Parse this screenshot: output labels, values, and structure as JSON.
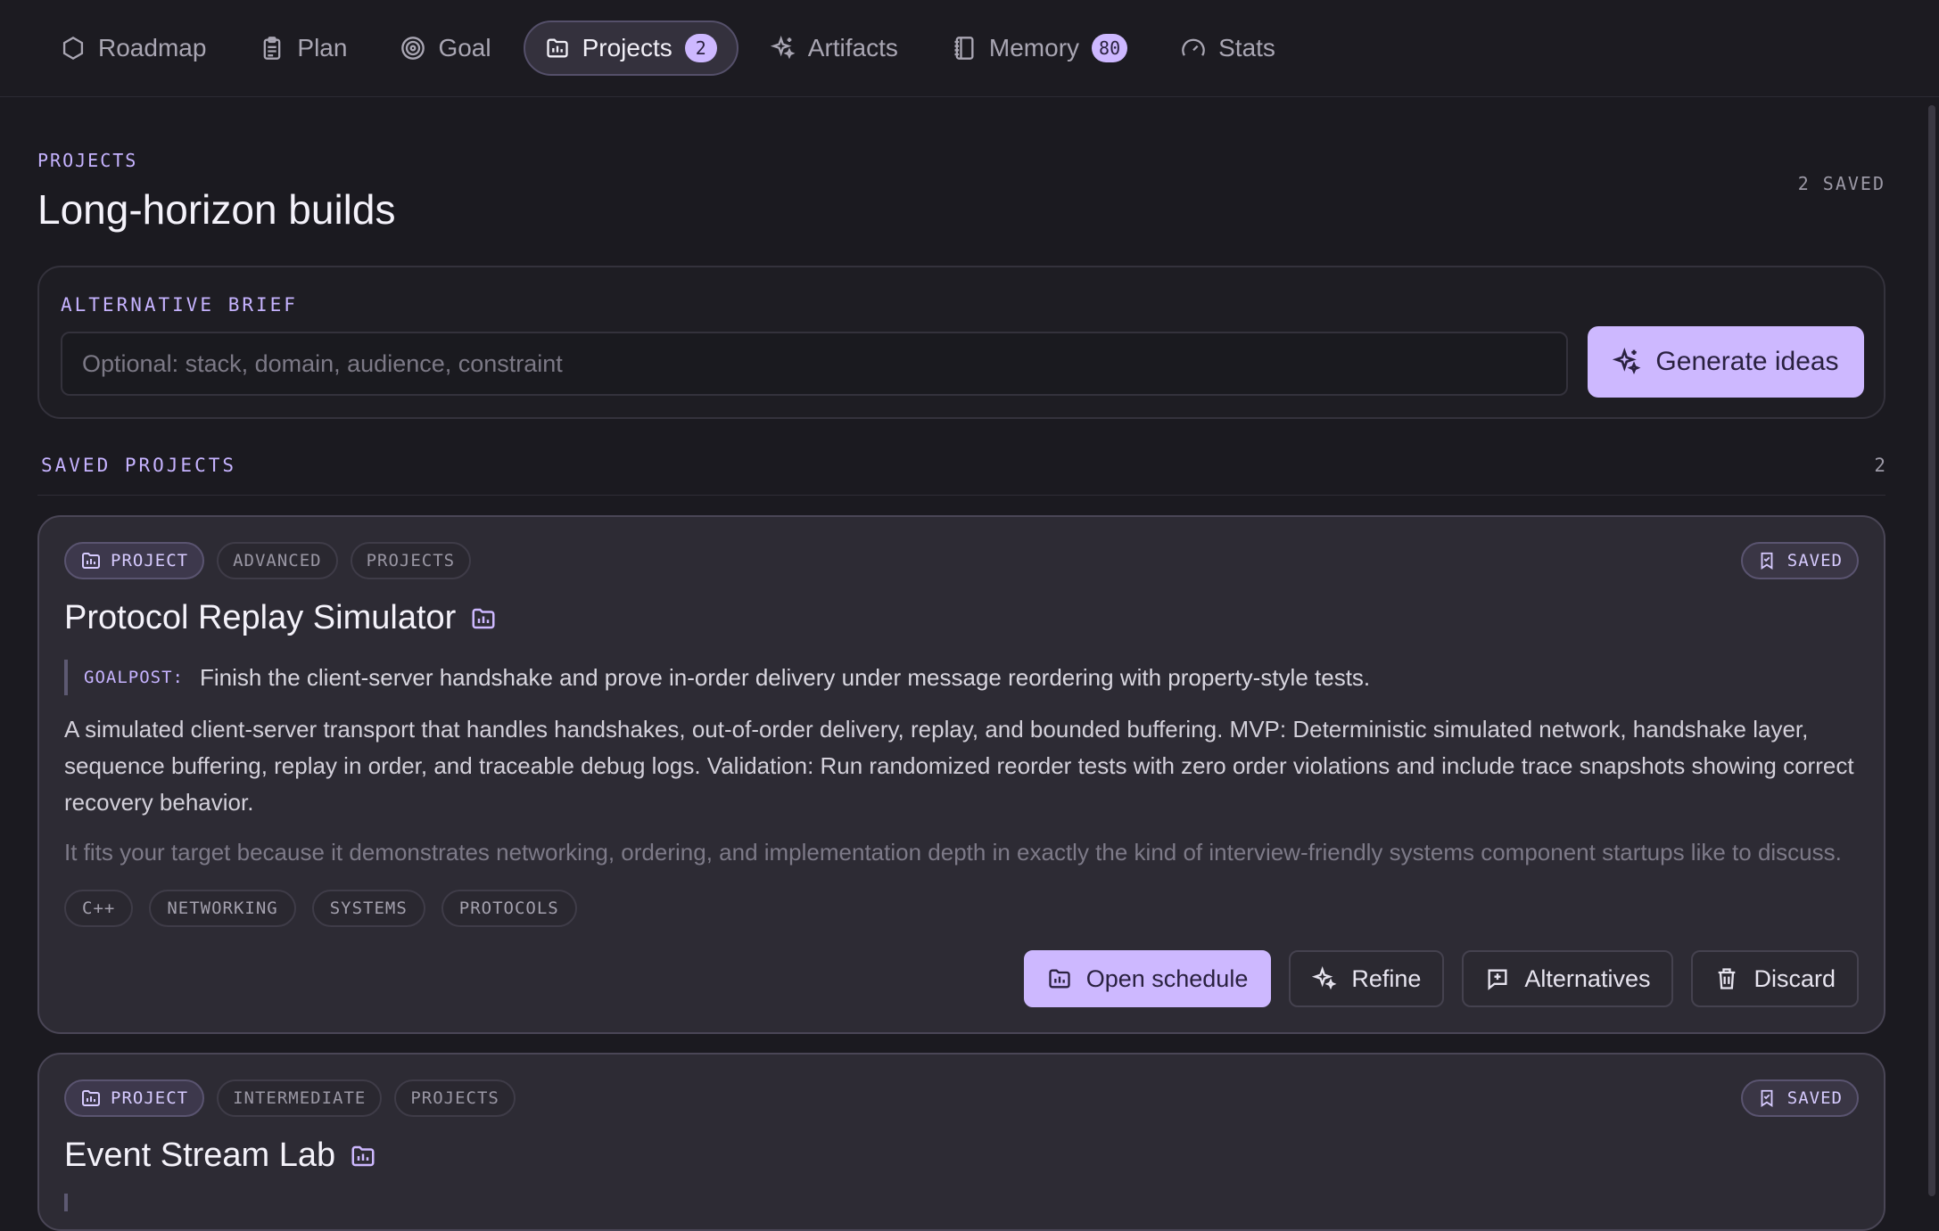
{
  "nav": {
    "tabs": [
      {
        "label": "Roadmap",
        "icon": "hexagon-icon"
      },
      {
        "label": "Plan",
        "icon": "clipboard-icon"
      },
      {
        "label": "Goal",
        "icon": "target-icon"
      },
      {
        "label": "Projects",
        "icon": "folder-icon",
        "count": "2",
        "active": true
      },
      {
        "label": "Artifacts",
        "icon": "sparkles-icon"
      },
      {
        "label": "Memory",
        "icon": "notebook-icon",
        "count": "80"
      },
      {
        "label": "Stats",
        "icon": "gauge-icon"
      }
    ]
  },
  "header": {
    "kicker": "PROJECTS",
    "title": "Long-horizon builds",
    "saved_count": "2 SAVED"
  },
  "brief": {
    "label": "ALTERNATIVE BRIEF",
    "placeholder": "Optional: stack, domain, audience, constraint",
    "value": "",
    "generate_label": "Generate ideas"
  },
  "saved_section": {
    "label": "SAVED PROJECTS",
    "count": "2"
  },
  "projects": [
    {
      "type_chip": "PROJECT",
      "level": "ADVANCED",
      "category": "PROJECTS",
      "saved_label": "SAVED",
      "title": "Protocol Replay Simulator",
      "goalpost_label": "GOALPOST:",
      "goalpost": "Finish the client-server handshake and prove in-order delivery under message reordering with property-style tests.",
      "description": "A simulated client-server transport that handles handshakes, out-of-order delivery, replay, and bounded buffering. MVP: Deterministic simulated network, handshake layer, sequence buffering, replay in order, and traceable debug logs. Validation: Run randomized reorder tests with zero order violations and include trace snapshots showing correct recovery behavior.",
      "fit": "It fits your target because it demonstrates networking, ordering, and implementation depth in exactly the kind of interview-friendly systems component startups like to discuss.",
      "tags": [
        "C++",
        "NETWORKING",
        "SYSTEMS",
        "PROTOCOLS"
      ],
      "actions": {
        "open_schedule": "Open schedule",
        "refine": "Refine",
        "alternatives": "Alternatives",
        "discard": "Discard"
      }
    },
    {
      "type_chip": "PROJECT",
      "level": "INTERMEDIATE",
      "category": "PROJECTS",
      "saved_label": "SAVED",
      "title": "Event Stream Lab"
    }
  ],
  "colors": {
    "accent": "#cdb8ff",
    "background": "#1b1a20",
    "card": "#2d2b34"
  }
}
